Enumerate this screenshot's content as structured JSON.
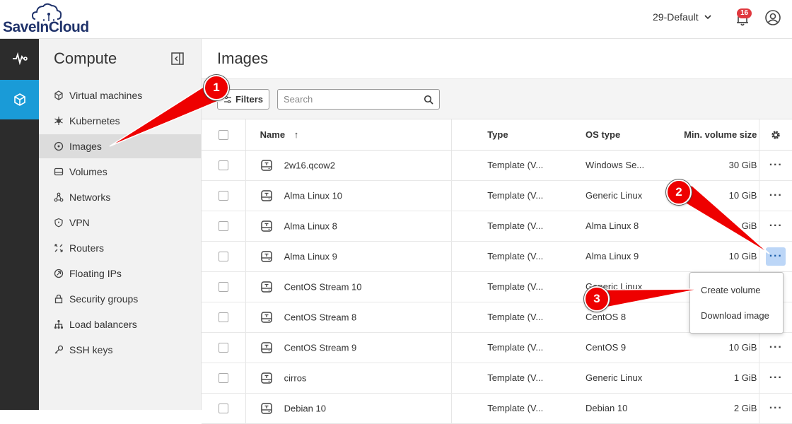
{
  "header": {
    "logo_text": "SaveInCloud",
    "project": "29-Default",
    "notifications_count": "16"
  },
  "rail": {
    "items": [
      {
        "icon": "activity-icon",
        "active": false
      },
      {
        "icon": "cube-icon",
        "active": true
      }
    ]
  },
  "sidebar": {
    "title": "Compute",
    "items": [
      {
        "label": "Virtual machines",
        "icon": "cube-icon"
      },
      {
        "label": "Kubernetes",
        "icon": "kubernetes-icon"
      },
      {
        "label": "Images",
        "icon": "disc-icon",
        "active": true
      },
      {
        "label": "Volumes",
        "icon": "drive-icon"
      },
      {
        "label": "Networks",
        "icon": "network-icon"
      },
      {
        "label": "VPN",
        "icon": "shield-icon"
      },
      {
        "label": "Routers",
        "icon": "router-icon"
      },
      {
        "label": "Floating IPs",
        "icon": "floating-ip-icon"
      },
      {
        "label": "Security groups",
        "icon": "lock-icon"
      },
      {
        "label": "Load balancers",
        "icon": "load-balancer-icon"
      },
      {
        "label": "SSH keys",
        "icon": "key-icon"
      }
    ]
  },
  "main": {
    "title": "Images",
    "filters_label": "Filters",
    "search_placeholder": "Search",
    "columns": {
      "name": "Name",
      "sort_indicator": "↑",
      "type": "Type",
      "os_type": "OS type",
      "min_volume_size": "Min. volume size"
    },
    "rows": [
      {
        "name": "2w16.qcow2",
        "type": "Template (V...",
        "os": "Windows Se...",
        "size": "30 GiB"
      },
      {
        "name": "Alma Linux 10",
        "type": "Template (V...",
        "os": "Generic Linux",
        "size": "10 GiB"
      },
      {
        "name": "Alma Linux 8",
        "type": "Template (V...",
        "os": "Alma Linux 8",
        "size": "GiB"
      },
      {
        "name": "Alma Linux 9",
        "type": "Template (V...",
        "os": "Alma Linux 9",
        "size": "10 GiB",
        "menu_open": true
      },
      {
        "name": "CentOS Stream 10",
        "type": "Template (V...",
        "os": "Generic Linux",
        "size": ""
      },
      {
        "name": "CentOS Stream 8",
        "type": "Template (V...",
        "os": "CentOS 8",
        "size": ""
      },
      {
        "name": "CentOS Stream 9",
        "type": "Template (V...",
        "os": "CentOS 9",
        "size": "10 GiB"
      },
      {
        "name": "cirros",
        "type": "Template (V...",
        "os": "Generic Linux",
        "size": "1 GiB"
      },
      {
        "name": "Debian 10",
        "type": "Template (V...",
        "os": "Debian 10",
        "size": "2 GiB"
      }
    ],
    "row_menu": {
      "create_volume": "Create volume",
      "download_image": "Download image"
    }
  },
  "annotations": {
    "steps": [
      "1",
      "2",
      "3"
    ],
    "color": "#ee0000"
  }
}
